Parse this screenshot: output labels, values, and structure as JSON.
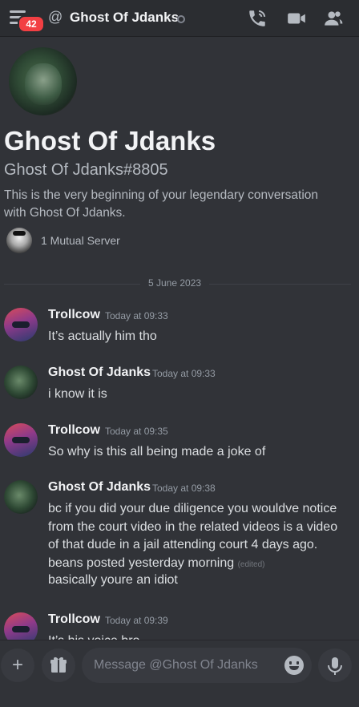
{
  "header": {
    "badge_count": "42",
    "at_symbol": "@",
    "title": "Ghost Of Jdanks"
  },
  "intro": {
    "name": "Ghost Of Jdanks",
    "tag": "Ghost Of Jdanks#8805",
    "description": "This is the very beginning of your legendary conversation with Ghost Of Jdanks.",
    "mutual": "1 Mutual Server"
  },
  "date_divider": "5 June 2023",
  "messages": [
    {
      "author": "Trollcow",
      "time": "Today at 09:33",
      "text": "It’s actually him tho"
    },
    {
      "author": "Ghost Of Jdanks",
      "time": "Today at 09:33",
      "text": "i know it is"
    },
    {
      "author": "Trollcow",
      "time": "Today at 09:35",
      "text": "So why is this all being made a joke of"
    },
    {
      "author": "Ghost Of Jdanks",
      "time": "Today at 09:38",
      "text": "bc if you did your due diligence you wouldve notice from the court video in the related videos is a video of that dude in a jail attending court 4 days ago. beans posted yesterday morning",
      "edited": "(edited)",
      "text2": "basically youre an idiot"
    },
    {
      "author": "Trollcow",
      "time": "Today at 09:39",
      "text": "It’s his voice bro"
    }
  ],
  "composer": {
    "placeholder": "Message @Ghost Of Jdanks"
  },
  "icons": [
    "menu-icon",
    "at-icon",
    "voice-call-icon",
    "video-call-icon",
    "members-icon",
    "plus-icon",
    "gift-icon",
    "emoji-icon",
    "microphone-icon"
  ]
}
